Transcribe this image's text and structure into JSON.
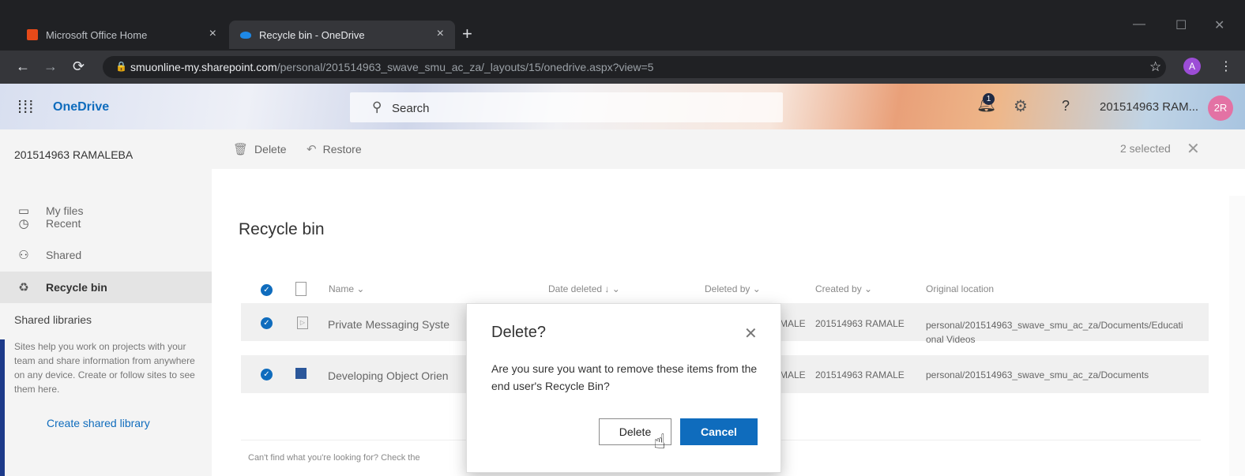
{
  "browser": {
    "tabs": [
      {
        "title": "Microsoft Office Home",
        "close": "×"
      },
      {
        "title": "Recycle bin - OneDrive",
        "close": "×"
      }
    ],
    "new_tab": "+",
    "window_controls": {
      "minimize": "—",
      "maximize": "☐",
      "close": "✕"
    },
    "url_host": "smuonline-my.sharepoint.com",
    "url_path": "/personal/201514963_swave_smu_ac_za/_layouts/15/onedrive.aspx?view=5",
    "profile_initial": "A",
    "profile_color": "#9c4dd6"
  },
  "header": {
    "app_name": "OneDrive",
    "search_placeholder": "Search",
    "notification_count": "1",
    "user_name": "201514963 RAM...",
    "avatar_initials": "2R",
    "avatar_color": "#e372a4"
  },
  "leftnav": {
    "account": "201514963 RAMALEBA",
    "items": [
      {
        "label": "My files",
        "icon": "folder-icon"
      },
      {
        "label": "Recent",
        "icon": "clock-icon"
      },
      {
        "label": "Shared",
        "icon": "people-icon"
      },
      {
        "label": "Recycle bin",
        "icon": "recycle-bin-icon"
      }
    ],
    "shared_libraries": "Shared libraries",
    "sites_help": "Sites help you work on projects with your team and share information from anywhere on any device. Create or follow sites to see them here.",
    "create_library": "Create shared library"
  },
  "commandbar": {
    "delete": "Delete",
    "restore": "Restore",
    "selected": "2 selected"
  },
  "main": {
    "title": "Recycle bin",
    "columns": {
      "name": "Name",
      "date_deleted": "Date deleted",
      "deleted_by": "Deleted by",
      "created_by": "Created by",
      "original_location": "Original location"
    },
    "rows": [
      {
        "name": "Private Messaging Syste",
        "deleted_by": "MALE",
        "created_by": "201514963 RAMALE",
        "location": "personal/201514963_swave_smu_ac_za/Documents/Educational Videos"
      },
      {
        "name": "Developing Object Orien",
        "deleted_by": "MALE",
        "created_by": "201514963 RAMALE",
        "location": "personal/201514963_swave_smu_ac_za/Documents"
      }
    ],
    "footer_hint": "Can't find what you're looking for? Check the"
  },
  "dialog": {
    "title": "Delete?",
    "message": "Are you sure you want to remove these items from the end user's Recycle Bin?",
    "delete_label": "Delete",
    "cancel_label": "Cancel"
  }
}
